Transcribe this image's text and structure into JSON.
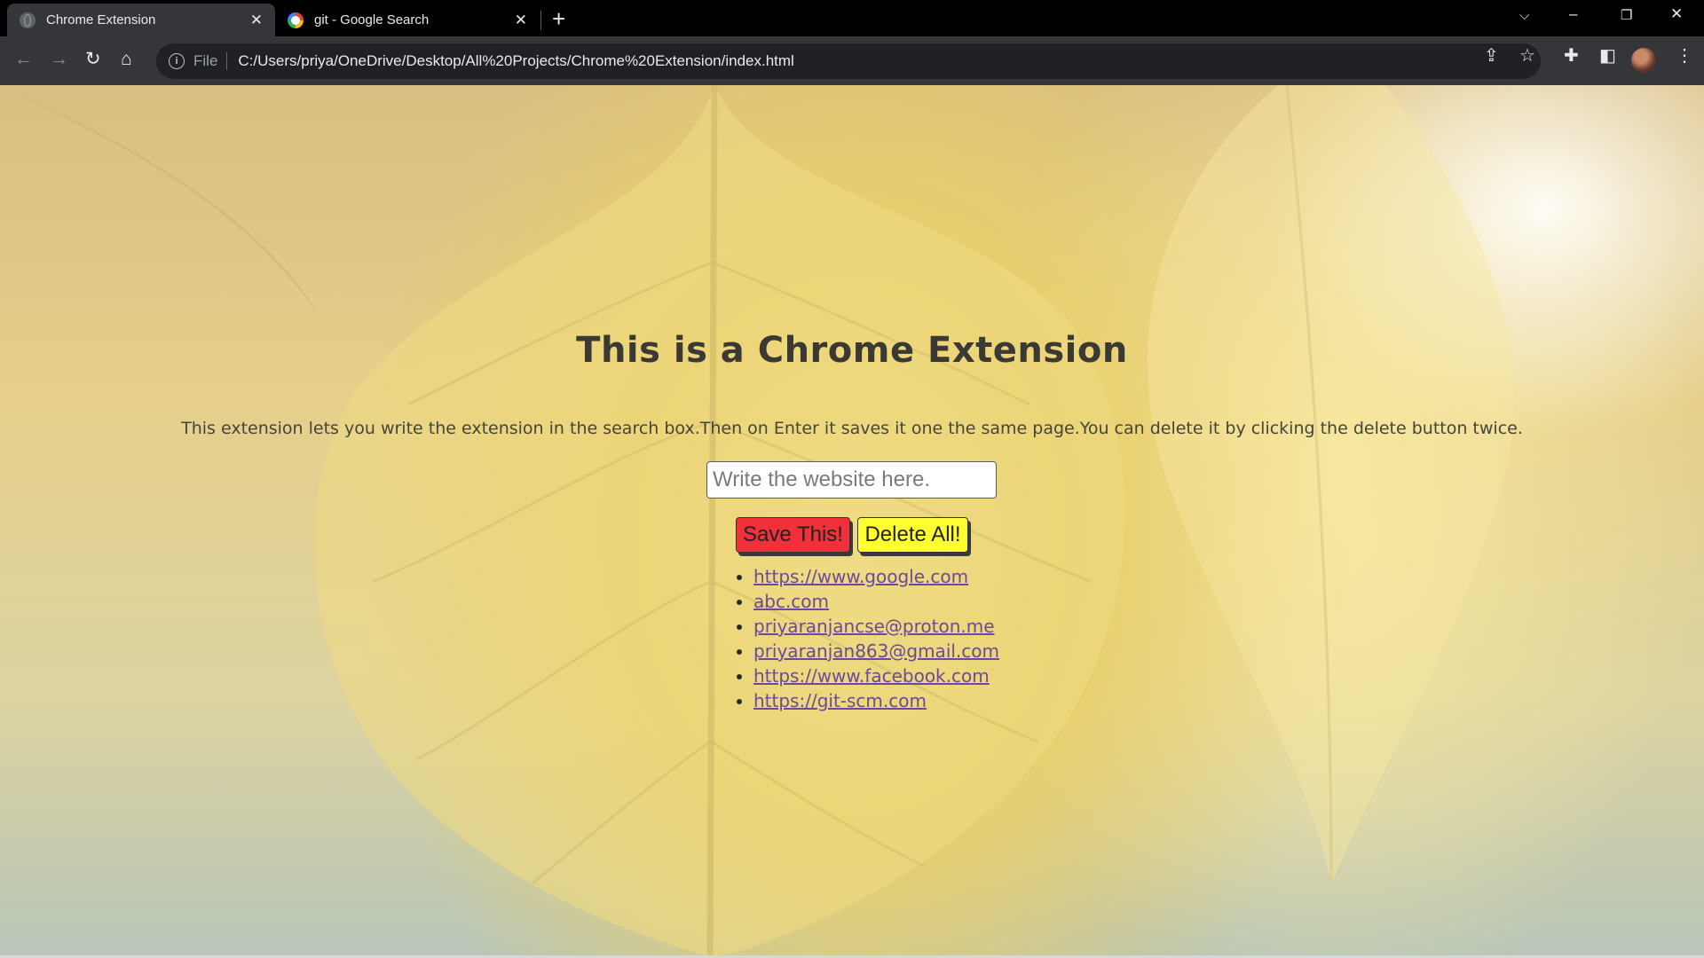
{
  "browser": {
    "tabs": [
      {
        "title": "Chrome Extension",
        "active": true,
        "favicon": "globe-icon"
      },
      {
        "title": "git - Google Search",
        "active": false,
        "favicon": "google-icon"
      }
    ],
    "new_tab_label": "+",
    "address": {
      "scheme": "File",
      "url": "C:/Users/priya/OneDrive/Desktop/All%20Projects/Chrome%20Extension/index.html"
    }
  },
  "page": {
    "title": "This is a Chrome Extension",
    "description": "This extension lets you write the extension in the search box.Then on Enter it saves it one the same page.You can delete it by clicking the delete button twice.",
    "input": {
      "placeholder": "Write the website here.",
      "value": ""
    },
    "save_label": "Save This!",
    "delete_label": "Delete All!",
    "links": [
      "https://www.google.com",
      "abc.com",
      "priyaranjancse@proton.me",
      "priyaranjan863@gmail.com",
      "https://www.facebook.com",
      "https://git-scm.com"
    ]
  },
  "colors": {
    "save_button": "#f0313a",
    "delete_button": "#ffff33",
    "link": "#6b4a9a"
  }
}
